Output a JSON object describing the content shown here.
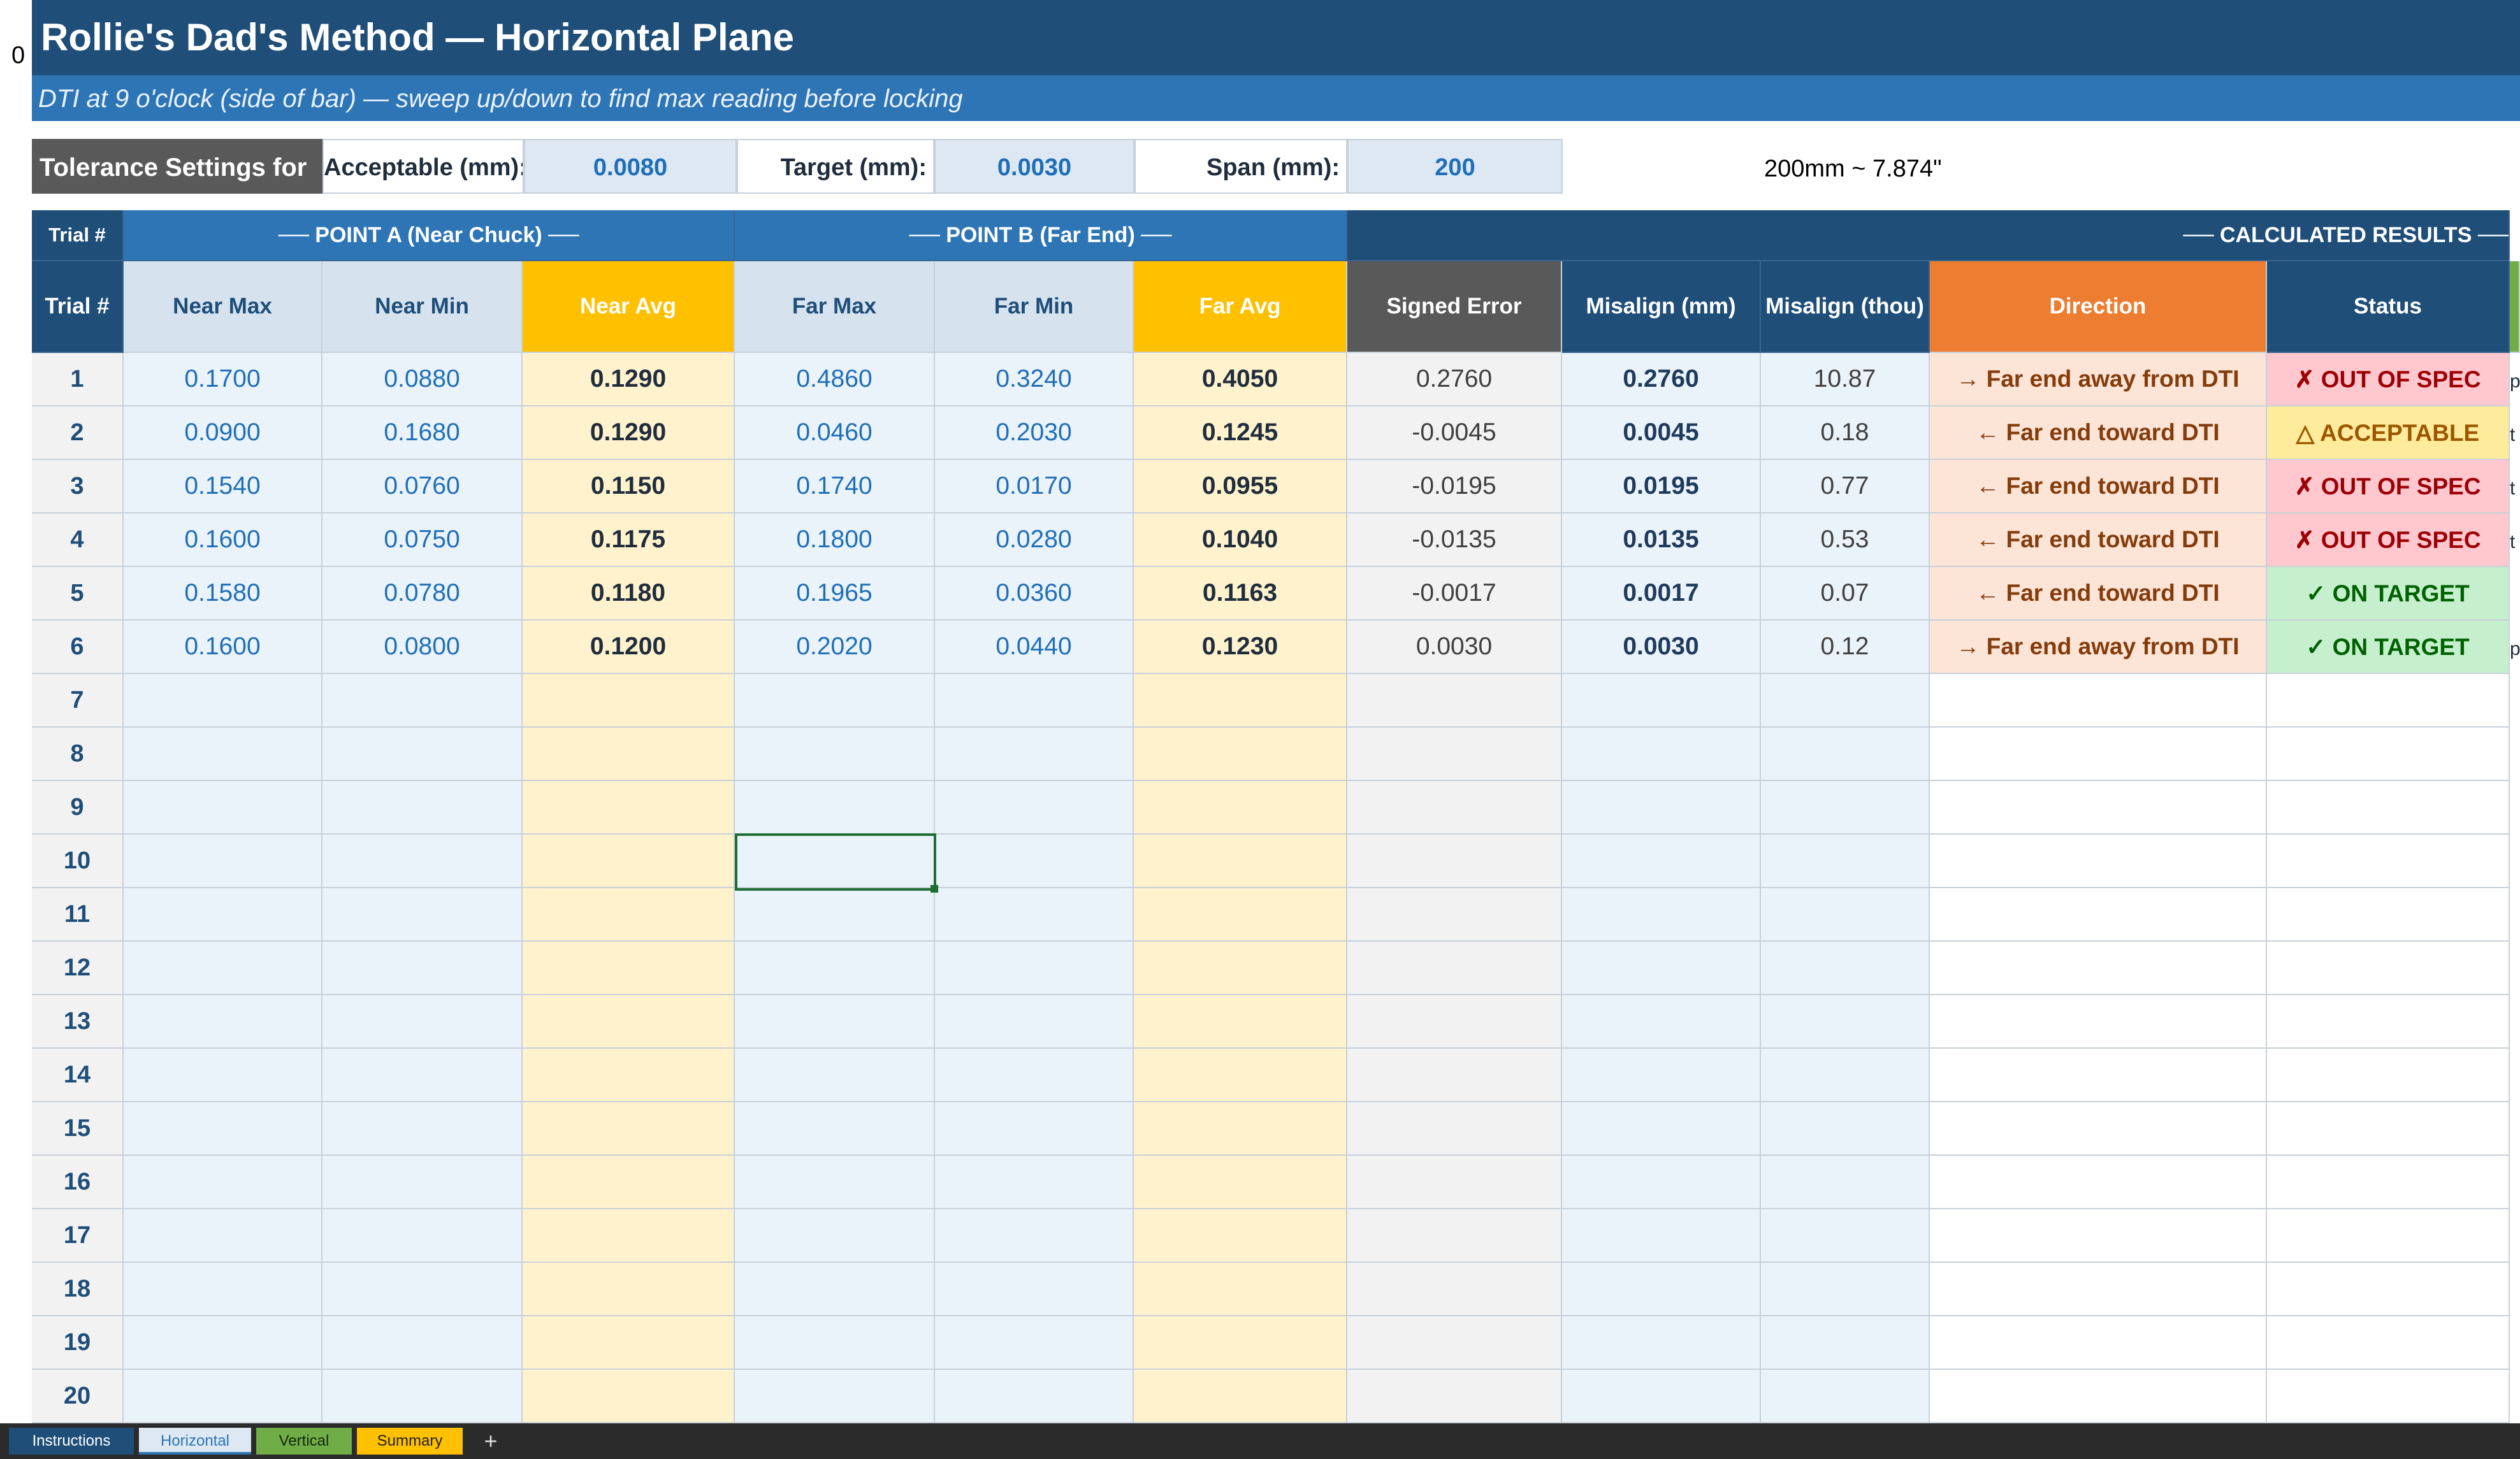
{
  "corner_label": "0",
  "title": "Rollie's Dad's Method — Horizontal Plane",
  "subtitle": "DTI at 9 o'clock (side of bar) — sweep up/down to find max reading before locking",
  "tolerance": {
    "label": "Tolerance Settings for",
    "acceptable_label": "Acceptable (mm):",
    "acceptable_value": "0.0080",
    "target_label": "Target (mm):",
    "target_value": "0.0030",
    "span_label": "Span (mm):",
    "span_value": "200",
    "note": "200mm ~ 7.874\""
  },
  "groups": {
    "trial": "Trial #",
    "point_a": "── POINT A (Near Chuck) ──",
    "point_b": "── POINT B (Far End) ──",
    "results": "── CALCULATED RESULTS ──"
  },
  "headers": [
    "Trial #",
    "Near Max",
    "Near Min",
    "Near Avg",
    "Far Max",
    "Far Min",
    "Far Avg",
    "Signed Error",
    "Misalign (mm)",
    "Misalign (thou)",
    "Direction",
    "Status"
  ],
  "rows": [
    {
      "trial": "1",
      "near_max": "0.1700",
      "near_min": "0.0880",
      "near_avg": "0.1290",
      "far_max": "0.4860",
      "far_min": "0.3240",
      "far_avg": "0.4050",
      "signed_error": "0.2760",
      "misalign_mm": "0.2760",
      "misalign_thou": "10.87",
      "direction": "→ Far end away from DTI",
      "status": "✗ OUT OF SPEC",
      "status_type": "out"
    },
    {
      "trial": "2",
      "near_max": "0.0900",
      "near_min": "0.1680",
      "near_avg": "0.1290",
      "far_max": "0.0460",
      "far_min": "0.2030",
      "far_avg": "0.1245",
      "signed_error": "-0.0045",
      "misalign_mm": "0.0045",
      "misalign_thou": "0.18",
      "direction": "← Far end toward DTI",
      "status": "△ ACCEPTABLE",
      "status_type": "acc"
    },
    {
      "trial": "3",
      "near_max": "0.1540",
      "near_min": "0.0760",
      "near_avg": "0.1150",
      "far_max": "0.1740",
      "far_min": "0.0170",
      "far_avg": "0.0955",
      "signed_error": "-0.0195",
      "misalign_mm": "0.0195",
      "misalign_thou": "0.77",
      "direction": "← Far end toward DTI",
      "status": "✗ OUT OF SPEC",
      "status_type": "out"
    },
    {
      "trial": "4",
      "near_max": "0.1600",
      "near_min": "0.0750",
      "near_avg": "0.1175",
      "far_max": "0.1800",
      "far_min": "0.0280",
      "far_avg": "0.1040",
      "signed_error": "-0.0135",
      "misalign_mm": "0.0135",
      "misalign_thou": "0.53",
      "direction": "← Far end toward DTI",
      "status": "✗ OUT OF SPEC",
      "status_type": "out"
    },
    {
      "trial": "5",
      "near_max": "0.1580",
      "near_min": "0.0780",
      "near_avg": "0.1180",
      "far_max": "0.1965",
      "far_min": "0.0360",
      "far_avg": "0.1163",
      "signed_error": "-0.0017",
      "misalign_mm": "0.0017",
      "misalign_thou": "0.07",
      "direction": "← Far end toward DTI",
      "status": "✓ ON TARGET",
      "status_type": "on"
    },
    {
      "trial": "6",
      "near_max": "0.1600",
      "near_min": "0.0800",
      "near_avg": "0.1200",
      "far_max": "0.2020",
      "far_min": "0.0440",
      "far_avg": "0.1230",
      "signed_error": "0.0030",
      "misalign_mm": "0.0030",
      "misalign_thou": "0.12",
      "direction": "→ Far end away from DTI",
      "status": "✓ ON TARGET",
      "status_type": "on"
    }
  ],
  "empty_rows": [
    "7",
    "8",
    "9",
    "10",
    "11",
    "12",
    "13",
    "14",
    "15",
    "16",
    "17",
    "18",
    "19",
    "20"
  ],
  "cutoff_column_letters": [
    "p",
    "t",
    "t",
    "t",
    "",
    "p"
  ],
  "sheet_tabs": {
    "instructions": "Instructions",
    "horizontal": "Horizontal",
    "vertical": "Vertical",
    "summary": "Summary",
    "add": "+"
  },
  "colors": {
    "header_navy": "#1f4e79",
    "subtitle_blue": "#2e75b6",
    "gold": "#ffc000",
    "orange": "#ed7d31",
    "out_of_spec": "#ffc7ce",
    "acceptable": "#ffeb9c",
    "on_target": "#c6efce"
  }
}
